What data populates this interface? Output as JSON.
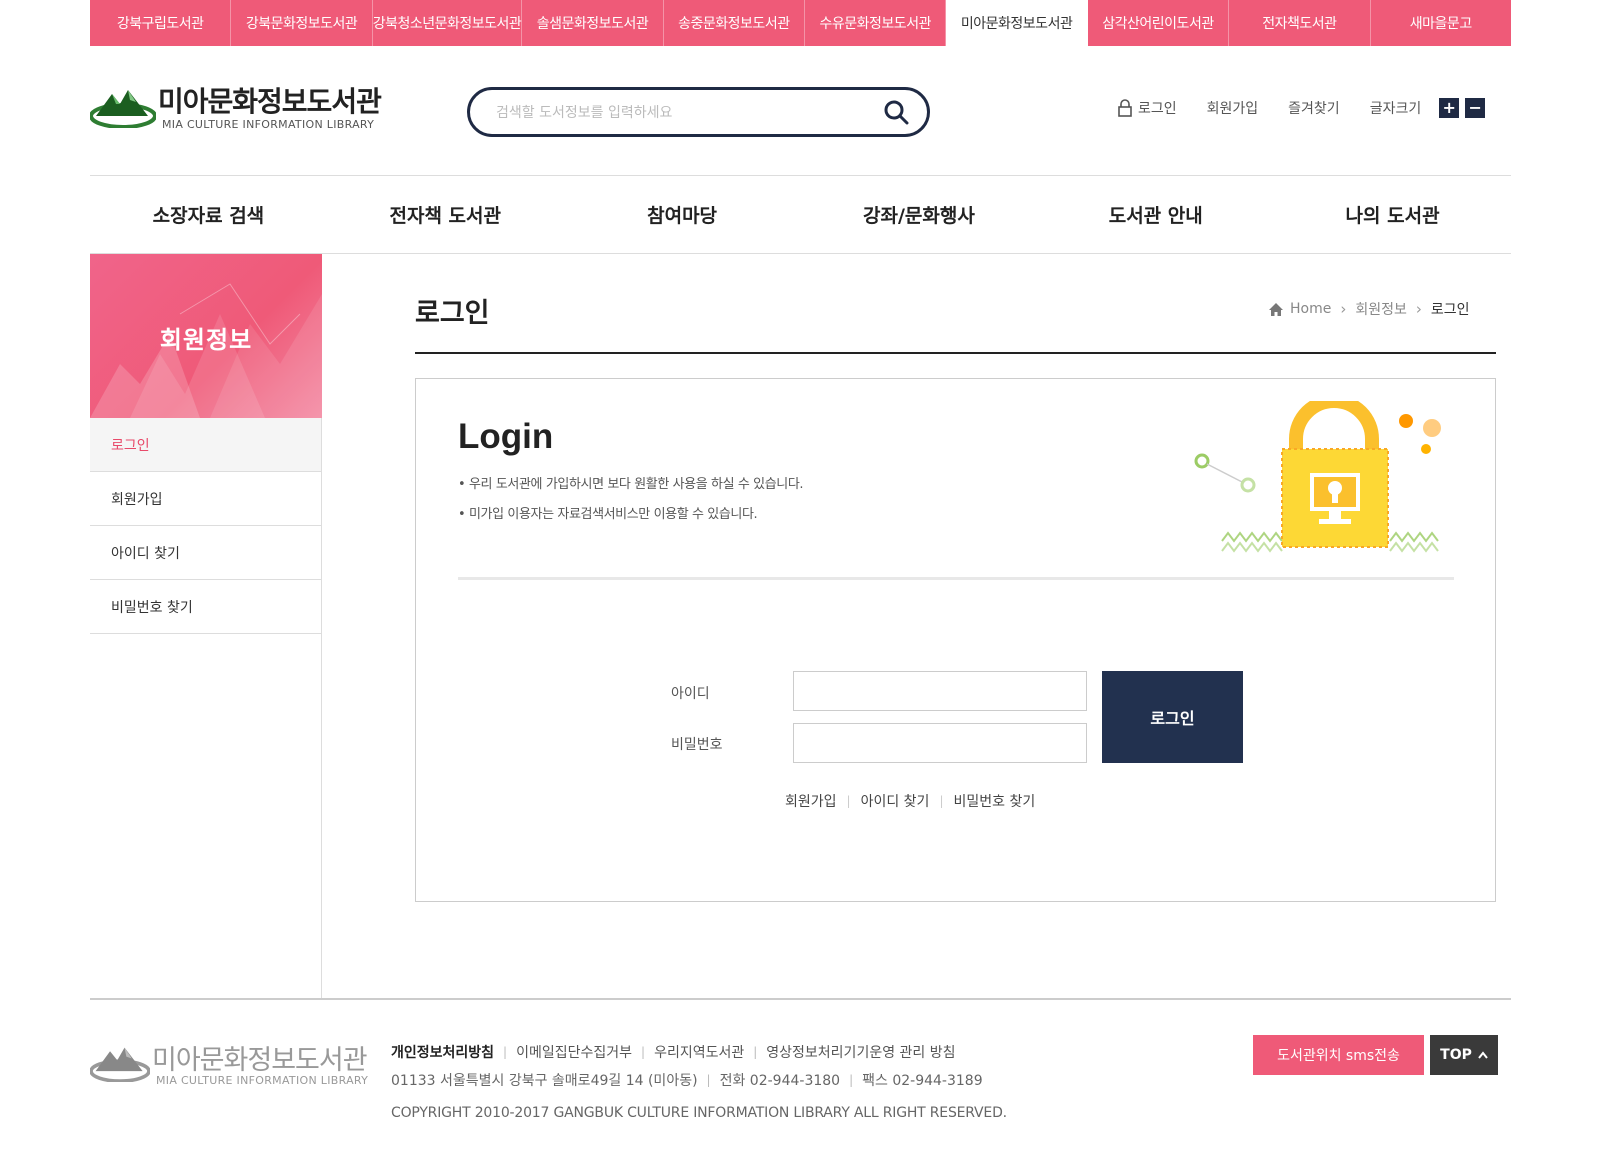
{
  "libraries": [
    {
      "label": "강북구립도서관"
    },
    {
      "label": "강북문화정보도서관"
    },
    {
      "label": "강북청소년문화정보도서관"
    },
    {
      "label": "솔샘문화정보도서관"
    },
    {
      "label": "송중문화정보도서관"
    },
    {
      "label": "수유문화정보도서관"
    },
    {
      "label": "미아문화정보도서관",
      "active": true
    },
    {
      "label": "삼각산어린이도서관"
    },
    {
      "label": "전자책도서관"
    },
    {
      "label": "새마을문고"
    }
  ],
  "header": {
    "logo_ko": "미아문화정보도서관",
    "logo_en": "MIA CULTURE INFORMATION LIBRARY",
    "search_placeholder": "검색할 도서정보를 입력하세요",
    "util": {
      "login": "로그인",
      "join": "회원가입",
      "favorite": "즐겨찾기",
      "font_size": "글자크기",
      "font_plus": "+",
      "font_minus": "−"
    }
  },
  "gnb": [
    "소장자료 검색",
    "전자책 도서관",
    "참여마당",
    "강좌/문화행사",
    "도서관 안내",
    "나의 도서관"
  ],
  "sidebar": {
    "title": "회원정보",
    "items": [
      {
        "label": "로그인",
        "active": true
      },
      {
        "label": "회원가입"
      },
      {
        "label": "아이디 찾기"
      },
      {
        "label": "비밀번호 찾기"
      }
    ]
  },
  "page": {
    "title": "로그인",
    "breadcrumb": {
      "home": "Home",
      "section": "회원정보",
      "current": "로그인"
    }
  },
  "login": {
    "heading": "Login",
    "desc1": "• 우리 도서관에 가입하시면 보다 원활한 사용을 하실 수 있습니다.",
    "desc2": "• 미가입 이용자는 자료검색서비스만 이용할 수 있습니다.",
    "id_label": "아이디",
    "pw_label": "비밀번호",
    "id_value": "",
    "pw_value": "",
    "button": "로그인",
    "links": {
      "join": "회원가입",
      "find_id": "아이디 찾기",
      "find_pw": "비밀번호 찾기"
    }
  },
  "footer": {
    "logo_ko": "미아문화정보도서관",
    "logo_en": "MIA CULTURE INFORMATION LIBRARY",
    "links": [
      "개인정보처리방침",
      "이메일집단수집거부",
      "우리지역도서관",
      "영상정보처리기기운영 관리 방침"
    ],
    "address": "01133 서울특별시 강북구 솔매로49길 14 (미아동)",
    "phone": "전화 02-944-3180",
    "fax": "팩스 02-944-3189",
    "copyright": "COPYRIGHT 2010-2017 GANGBUK CULTURE INFORMATION LIBRARY ALL RIGHT RESERVED.",
    "sms_button": "도서관위치 sms전송",
    "top_button": "TOP"
  },
  "colors": {
    "brand_pink": "#ef5a78",
    "navy": "#1f2a44",
    "button_navy": "#22314f",
    "logo_green": "#2e7d32"
  },
  "icons": {
    "search": "search-icon",
    "lock": "lock-icon",
    "home": "home-icon",
    "top_arrow": "chevron-up-icon"
  }
}
